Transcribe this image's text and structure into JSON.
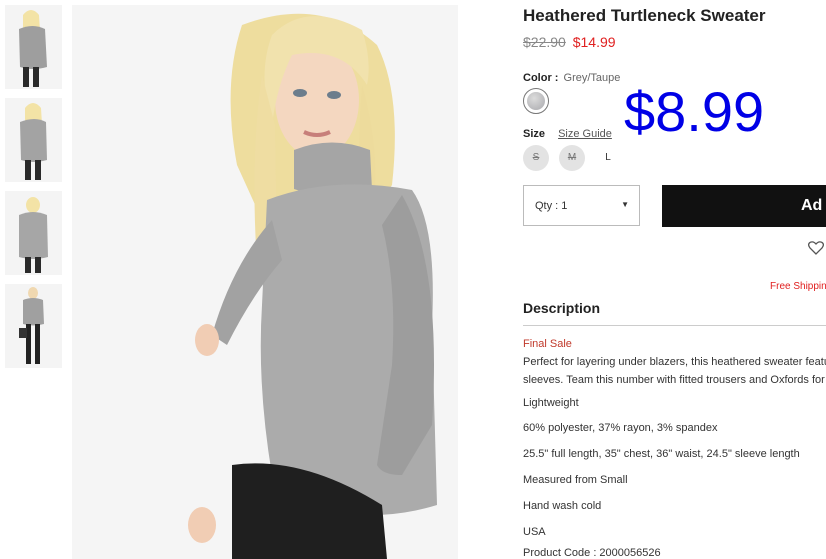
{
  "thumbnails": [
    {
      "alt": "front view"
    },
    {
      "alt": "side view"
    },
    {
      "alt": "back view"
    },
    {
      "alt": "full length view"
    }
  ],
  "product": {
    "title": "Heathered Turtleneck Sweater",
    "price_original": "$22.90",
    "price_sale": "$14.99",
    "overlay_price": "$8.99"
  },
  "color": {
    "label": "Color :",
    "value": "Grey/Taupe",
    "swatch_hex": "#b3b3b7"
  },
  "size": {
    "label": "Size",
    "guide_label": "Size Guide",
    "options": [
      {
        "label": "S",
        "available": false
      },
      {
        "label": "M",
        "available": false
      },
      {
        "label": "L",
        "available": true
      }
    ]
  },
  "quantity": {
    "label": "Qty : 1"
  },
  "add_to_bag": {
    "label": "Ad"
  },
  "shipping": {
    "text": "Free Shippin"
  },
  "description": {
    "title": "Description",
    "final_sale": "Final Sale",
    "lines": [
      "Perfect for layering under blazers, this heathered sweater featu",
      "sleeves. Team this number with fitted trousers and Oxfords for a",
      "Lightweight",
      "60% polyester, 37% rayon, 3% spandex",
      "25.5\" full length, 35\" chest, 36\" waist, 24.5\" sleeve length",
      "Measured from Small",
      "Hand wash cold",
      "USA",
      "Product Code : 2000056526"
    ]
  },
  "colors": {
    "accent_red": "#e02020",
    "overlay_blue": "#0000e6",
    "button_black": "#111111"
  }
}
